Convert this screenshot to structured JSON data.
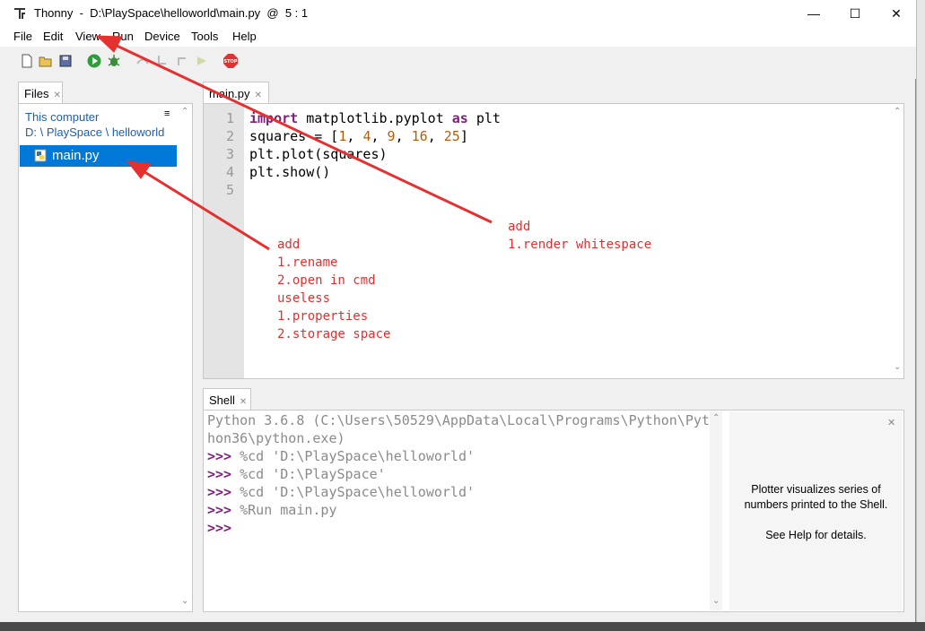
{
  "window": {
    "title": "Thonny  -  D:\\PlaySpace\\helloworld\\main.py  @  5 : 1",
    "minimize": "—",
    "maximize": "☐",
    "close": "✕"
  },
  "menu": [
    "File",
    "Edit",
    "View",
    "Run",
    "Device",
    "Tools",
    "Help"
  ],
  "toolbar_icons": [
    "new-file-icon",
    "open-file-icon",
    "save-file-icon",
    "run-icon",
    "debug-icon",
    "step-over-icon",
    "step-into-icon",
    "step-out-icon",
    "resume-icon",
    "stop-icon"
  ],
  "files": {
    "tab": "Files",
    "location": "This computer",
    "path": "D: \\ PlaySpace \\ helloworld",
    "menu_glyph": "≡",
    "items": [
      {
        "name": "main.py",
        "selected": true
      }
    ]
  },
  "editor": {
    "tab": "main.py",
    "line_numbers": [
      "1",
      "2",
      "3",
      "4",
      "5"
    ]
  },
  "shell": {
    "tab": "Shell",
    "lines": [
      "Python 3.6.8 (C:\\Users\\50529\\AppData\\Local\\Programs\\Python\\Pyt",
      "hon36\\python.exe)"
    ],
    "prompt": ">>>",
    "commands": [
      " %cd 'D:\\PlaySpace\\helloworld'",
      " %cd 'D:\\PlaySpace'",
      " %cd 'D:\\PlaySpace\\helloworld'",
      " %Run main.py",
      ""
    ],
    "plotter_text_1": "Plotter visualizes series of",
    "plotter_text_2": "numbers printed to the Shell.",
    "plotter_text_3": "See Help for details."
  },
  "annotations": {
    "right": [
      "add",
      "1.render whitespace"
    ],
    "left": [
      "add",
      "1.rename",
      "2.open in cmd",
      "useless",
      "1.properties",
      "2.storage space"
    ]
  },
  "colors": {
    "selection": "#0078d7",
    "keyword": "#7d1f7b",
    "number": "#b15d0f",
    "annotation": "#e03030",
    "path_link": "#1a5fb4"
  }
}
